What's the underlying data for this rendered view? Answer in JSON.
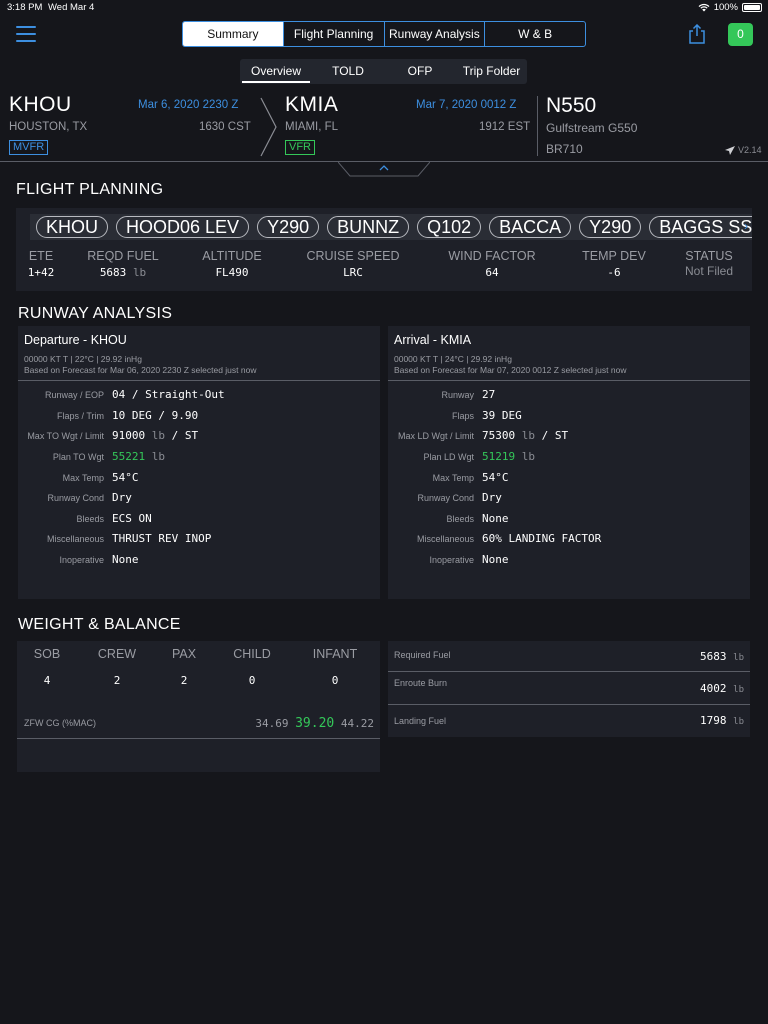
{
  "status": {
    "time": "3:18 PM",
    "date": "Wed Mar 4",
    "battery": "100%"
  },
  "nav": {
    "tabs": [
      "Summary",
      "Flight Planning",
      "Runway Analysis",
      "W & B"
    ],
    "subtabs": [
      "Overview",
      "TOLD",
      "OFP",
      "Trip Folder"
    ],
    "badge": "0"
  },
  "route": {
    "dep": {
      "code": "KHOU",
      "city": "HOUSTON, TX",
      "date_z": "Mar 6, 2020 2230 Z",
      "local": "1630 CST",
      "cat": "MVFR"
    },
    "arr": {
      "code": "KMIA",
      "city": "MIAMI, FL",
      "date_z": "Mar 7, 2020 0012 Z",
      "local": "1912 EST",
      "cat": "VFR"
    },
    "aircraft": {
      "tail": "N550",
      "type": "Gulfstream G550",
      "engine": "BR710",
      "version": "V2.14"
    }
  },
  "flight_planning": {
    "title": "FLIGHT PLANNING",
    "route_items": [
      "KHOU",
      "HOOD06 LEV",
      "Y290",
      "BUNNZ",
      "Q102",
      "BACCA",
      "Y290",
      "BAGGS SSC"
    ],
    "ete": {
      "label": "ETE",
      "value": "1+42"
    },
    "fuel": {
      "label": "REQD FUEL",
      "value": "5683",
      "unit": "lb"
    },
    "altitude": {
      "label": "ALTITUDE",
      "value": "FL490"
    },
    "speed": {
      "label": "CRUISE SPEED",
      "value": "LRC"
    },
    "wind": {
      "label": "WIND FACTOR",
      "value": "64"
    },
    "temp": {
      "label": "TEMP DEV",
      "value": "-6"
    },
    "status": {
      "label": "STATUS",
      "value": "Not Filed"
    }
  },
  "runway": {
    "title": "RUNWAY ANALYSIS",
    "departure": {
      "title": "Departure - KHOU",
      "wx": "00000 KT T | 22°C | 29.92 inHg",
      "basis": "Based on Forecast for Mar 06, 2020 2230 Z selected just now",
      "labels": {
        "runway": "Runway / EOP",
        "flaps": "Flaps / Trim",
        "max": "Max TO Wgt / Limit",
        "plan": "Plan TO Wgt",
        "temp": "Max Temp",
        "cond": "Runway Cond",
        "bleeds": "Bleeds",
        "misc": "Miscellaneous",
        "inop": "Inoperative"
      },
      "runway": "04 / Straight-Out",
      "flaps": "10 DEG / 9.90",
      "max_wgt": "91000",
      "max_unit": "lb",
      "max_limit": "/ ST",
      "plan_wgt": "55221",
      "plan_unit": "lb",
      "max_temp": "54°C",
      "cond": "Dry",
      "bleeds": "ECS ON",
      "misc": "THRUST REV INOP",
      "inop": "None"
    },
    "arrival": {
      "title": "Arrival - KMIA",
      "wx": "00000 KT T | 24°C | 29.92 inHg",
      "basis": "Based on Forecast for Mar 07, 2020 0012 Z selected just now",
      "labels": {
        "runway": "Runway",
        "flaps": "Flaps",
        "max": "Max LD Wgt / Limit",
        "plan": "Plan LD Wgt",
        "temp": "Max Temp",
        "cond": "Runway Cond",
        "bleeds": "Bleeds",
        "misc": "Miscellaneous",
        "inop": "Inoperative"
      },
      "runway": "27",
      "flaps": "39 DEG",
      "max_wgt": "75300",
      "max_unit": "lb",
      "max_limit": "/ ST",
      "plan_wgt": "51219",
      "plan_unit": "lb",
      "max_temp": "54°C",
      "cond": "Dry",
      "bleeds": "None",
      "misc": "60% LANDING FACTOR",
      "inop": "None"
    }
  },
  "wb": {
    "title": "WEIGHT & BALANCE",
    "cols": [
      {
        "label": "SOB",
        "value": "4"
      },
      {
        "label": "CREW",
        "value": "2"
      },
      {
        "label": "PAX",
        "value": "2"
      },
      {
        "label": "CHILD",
        "value": "0"
      },
      {
        "label": "INFANT",
        "value": "0"
      }
    ],
    "zfw_label": "ZFW CG (%MAC)",
    "zfw_min": "34.69",
    "zfw_val": "39.20",
    "zfw_max": "44.22",
    "fuel": [
      {
        "label": "Required Fuel",
        "value": "5683",
        "unit": "lb"
      },
      {
        "label": "Enroute Burn",
        "value": "4002",
        "unit": "lb"
      },
      {
        "label": "Landing Fuel",
        "value": "1798",
        "unit": "lb"
      }
    ]
  },
  "colors": {
    "accent": "#3d8fe0",
    "green": "#34c759",
    "panel": "#1e2028",
    "background": "#15161b"
  }
}
